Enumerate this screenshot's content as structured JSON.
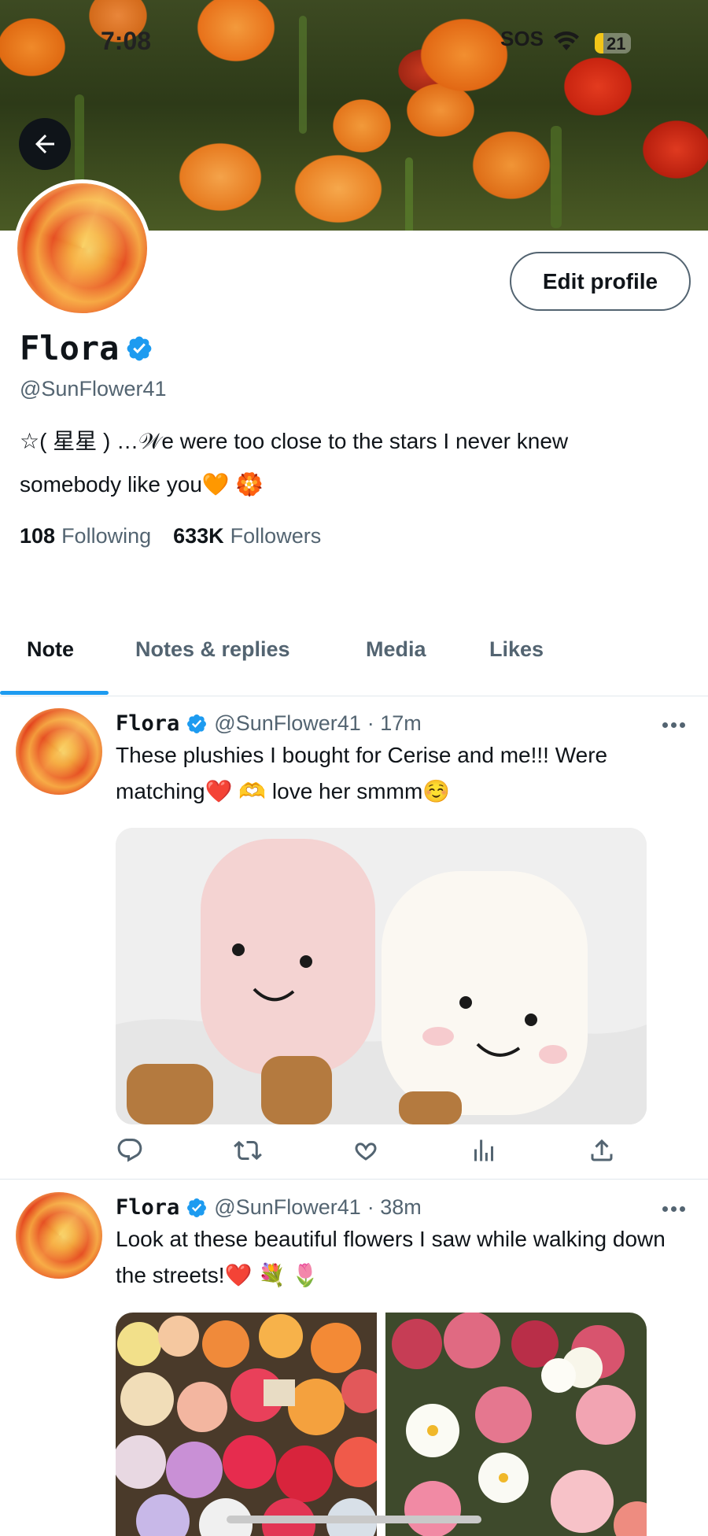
{
  "status_bar": {
    "time": "7:08",
    "sos": "SOS",
    "battery": "21"
  },
  "profile": {
    "name": "Flora",
    "handle": "@SunFlower41",
    "bio": "☆(     星星     ) …𝒲e were too close to the stars I never knew somebody like you🧡 🏵️",
    "edit_button": "Edit profile",
    "following_count": "108",
    "following_label": "Following",
    "followers_count": "633K",
    "followers_label": "Followers"
  },
  "tabs": [
    {
      "label": "Note",
      "active": true
    },
    {
      "label": "Notes & replies",
      "active": false
    },
    {
      "label": "Media",
      "active": false
    },
    {
      "label": "Likes",
      "active": false
    }
  ],
  "posts": [
    {
      "name": "Flora",
      "handle": "@SunFlower41",
      "time": "· 17m",
      "text": "These plushies I bought for Cerise and me!!! Were matching❤️ 🫶  love her smmm☺️",
      "media": "plushies-photo"
    },
    {
      "name": "Flora",
      "handle": "@SunFlower41",
      "time": "· 38m",
      "text": "Look at these beautiful flowers I saw while walking down the streets!❤️ 💐 🌷",
      "media": "flowers-photos"
    }
  ],
  "icons": {
    "back": "arrow-left-icon",
    "verified": "verified-badge-icon",
    "more": "more-dots-icon",
    "reply": "reply-icon",
    "retweet": "retweet-icon",
    "like": "heart-icon",
    "views": "views-icon",
    "share": "share-icon"
  },
  "colors": {
    "accent": "#1d9bf0",
    "text": "#0f1419",
    "secondary": "#536471"
  }
}
